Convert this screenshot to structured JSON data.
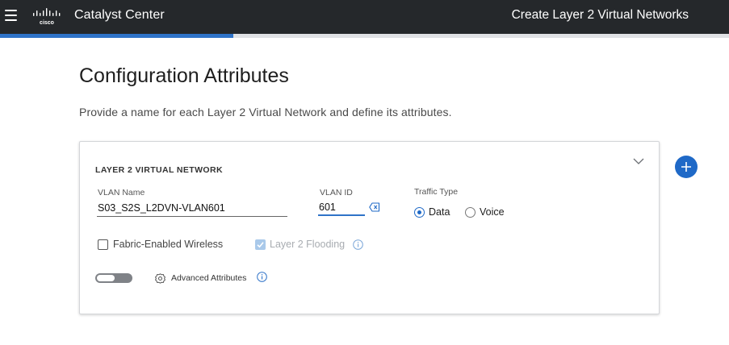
{
  "header": {
    "app_title": "Catalyst Center",
    "wizard_title": "Create Layer 2 Virtual Networks",
    "logo_text": "cisco",
    "menu_icon": "hamburger-menu-icon"
  },
  "progress": {
    "fraction": 0.32,
    "color": "#2f73c8"
  },
  "page": {
    "title": "Configuration Attributes",
    "subtitle": "Provide a name for each Layer 2 Virtual Network and define its attributes."
  },
  "card": {
    "title": "LAYER 2 VIRTUAL NETWORK",
    "collapse_icon": "chevron-down-icon",
    "vlan_name": {
      "label": "VLAN Name",
      "value": "S03_S2S_L2DVN-VLAN601"
    },
    "vlan_id": {
      "label": "VLAN ID",
      "value": "601",
      "clear_icon": "clear-input-icon"
    },
    "traffic_type": {
      "label": "Traffic Type",
      "options": [
        {
          "label": "Data",
          "selected": true
        },
        {
          "label": "Voice",
          "selected": false
        }
      ]
    },
    "fabric_wireless": {
      "label": "Fabric-Enabled Wireless",
      "checked": false
    },
    "layer2_flooding": {
      "label": "Layer 2 Flooding",
      "checked": true,
      "disabled": true
    },
    "advanced": {
      "label": "Advanced Attributes",
      "enabled": false
    }
  },
  "actions": {
    "add_icon": "plus-icon"
  },
  "colors": {
    "accent": "#1f69c7",
    "header_bg": "#25282b"
  }
}
